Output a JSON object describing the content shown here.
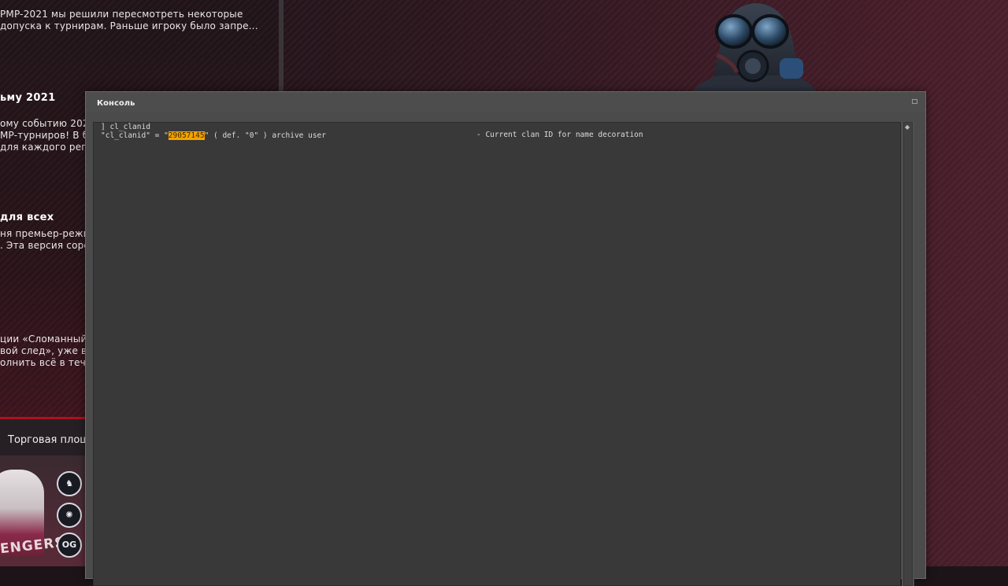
{
  "news": {
    "item1_line1": "PMP-2021 мы решили пересмотреть некоторые",
    "item1_line2": "допуска к турнирам. Раньше игроку было запре...",
    "item2_title": "ьму 2021",
    "item2_line1": "ому событию 2021",
    "item2_line2": "MP-турниров! В бл",
    "item2_line3": "для каждого рег",
    "item3_title": "для всех",
    "item3_line1": "ня премьер-режи",
    "item3_line2": ". Эта версия соре",
    "item4_line1": "ции «Сломанный",
    "item4_line2": "вой след», уже вы",
    "item4_line3": "олнить всё в тече"
  },
  "market": {
    "label": "Торговая площ",
    "sticker_word": "ENGERS",
    "team_logos": [
      "liquid-logo",
      "navi-logo",
      "og-logo"
    ],
    "og_label": "OG"
  },
  "console": {
    "title": "Консоль",
    "command_line": "] cl_clanid",
    "var_prefix": "\"cl_clanid\" = \"",
    "var_value": "29057145",
    "var_suffix": "\" ( def. \"0\" ) archive user",
    "help": "- Current clan ID for name decoration",
    "colors": {
      "window": "#4b4b4b",
      "output": "#393939",
      "highlight": "#f5a300"
    }
  }
}
